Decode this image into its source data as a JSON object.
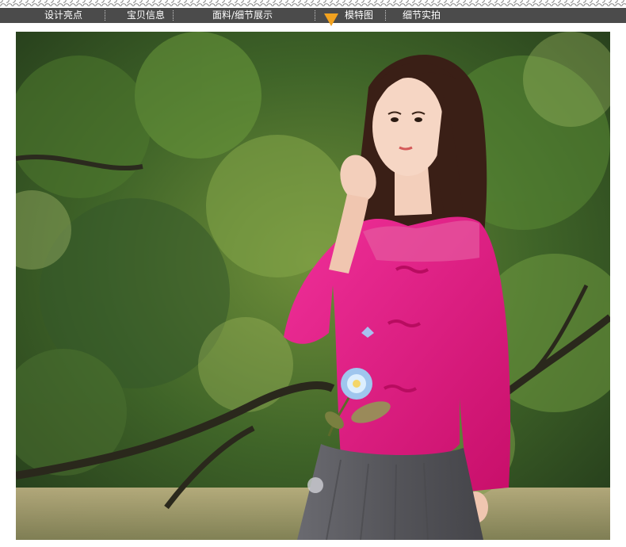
{
  "nav": {
    "items": [
      {
        "label": "设计亮点"
      },
      {
        "label": "宝贝信息"
      },
      {
        "label": "面料/细节展示"
      },
      {
        "label": "模特图"
      },
      {
        "label": "细节实拍"
      }
    ],
    "active_index": 3
  },
  "colors": {
    "nav_bg": "#4b4b4b",
    "nav_text": "#ffffff",
    "active_marker": "#f2a21f",
    "garment": "#e0187a",
    "skirt": "#5a5a5e",
    "foliage": "#3f6b2a"
  },
  "photo": {
    "icon": "model-photo-image"
  }
}
